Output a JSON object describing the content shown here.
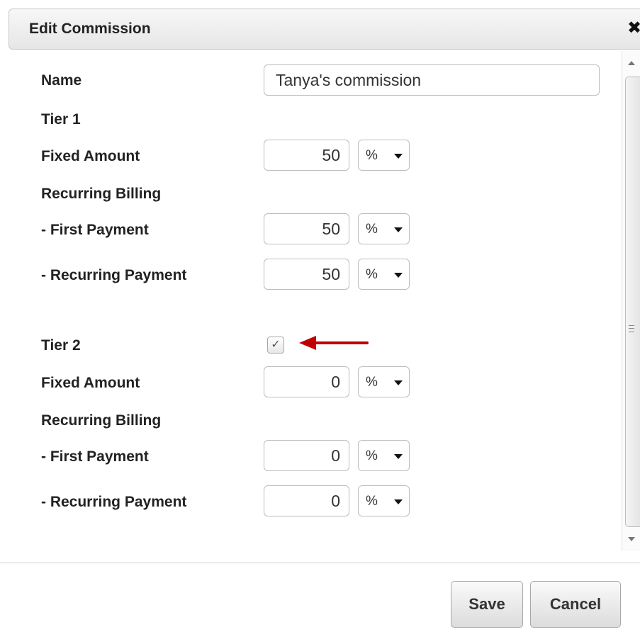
{
  "dialog": {
    "title": "Edit Commission",
    "close_glyph": "✖"
  },
  "form": {
    "name_label": "Name",
    "name_value": "Tanya's commission",
    "tier1": {
      "label": "Tier 1",
      "fixed_label": "Fixed Amount",
      "fixed_value": "50",
      "fixed_unit": "%",
      "recurring_label": "Recurring Billing",
      "first_label": "- First Payment",
      "first_value": "50",
      "first_unit": "%",
      "recur_label": "- Recurring Payment",
      "recur_value": "50",
      "recur_unit": "%"
    },
    "tier2": {
      "label": "Tier 2",
      "enabled_glyph": "✓",
      "enabled": true,
      "fixed_label": "Fixed Amount",
      "fixed_value": "0",
      "fixed_unit": "%",
      "recurring_label": "Recurring Billing",
      "first_label": "- First Payment",
      "first_value": "0",
      "first_unit": "%",
      "recur_label": "- Recurring Payment",
      "recur_value": "0",
      "recur_unit": "%"
    }
  },
  "footer": {
    "save_label": "Save",
    "cancel_label": "Cancel"
  },
  "annotation": {
    "arrow_color": "#c00000"
  }
}
